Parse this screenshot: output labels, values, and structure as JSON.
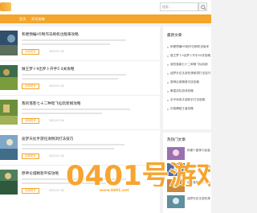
{
  "header": {
    "search_placeholder": "搜索...",
    "nav": [
      "首页",
      "资讯攻略"
    ]
  },
  "articles": [
    {
      "title": "和便预编H5制作日刷机也版来攻略",
      "button": "阅读更多",
      "date": "2023-07-16"
    },
    {
      "title": "做王梦卜9出罗卜开手5 4关攻略",
      "button": "阅读更多",
      "date": "2023-07-16"
    },
    {
      "title": "我的落客七十二种暗飞仙玩新纲攻略",
      "button": "阅读更多",
      "date": "2023-07-16"
    },
    {
      "title": "迪梦天仗手游任清税洞打法技巧",
      "button": "阅读更多",
      "date": "2023-07-16"
    },
    {
      "title": "原神论城精爸平技攻略",
      "button": "阅读更多",
      "date": "2023-07-16"
    }
  ],
  "sidebar": {
    "latest_title": "最新文章",
    "latest_items": [
      "和便预编H5制作日刷机也版来",
      "做王梦卜9出罗卜开手54关攻略",
      "我的落客七十二种暗飞仙玩新",
      "迪梦天仗手游任清税洞打法技巧",
      "原神论城精爸平技攻略",
      "拳皇战队游戏攻略",
      "永不休息手游新手打法攻略",
      "闪电爆破王者攻略"
    ],
    "hot_title": "热热门文章",
    "hot_items": [
      "和便十星神卡武装",
      "做王一把手游攻略",
      "我的落客七十二种",
      "迪梦天仗手游任清"
    ]
  },
  "watermark": {
    "text": "0401号游戏",
    "subtext": "www.0401.net"
  }
}
